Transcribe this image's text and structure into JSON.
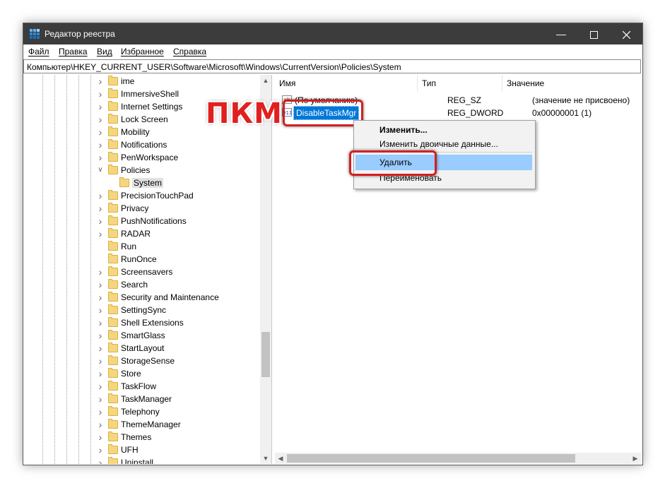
{
  "window": {
    "title": "Редактор реестра"
  },
  "menu": [
    "Файл",
    "Правка",
    "Вид",
    "Избранное",
    "Справка"
  ],
  "address": "Компьютер\\HKEY_CURRENT_USER\\Software\\Microsoft\\Windows\\CurrentVersion\\Policies\\System",
  "tree": {
    "items": [
      {
        "label": "ime",
        "expandable": true
      },
      {
        "label": "ImmersiveShell",
        "expandable": true
      },
      {
        "label": "Internet Settings",
        "expandable": true
      },
      {
        "label": "Lock Screen",
        "expandable": true
      },
      {
        "label": "Mobility",
        "expandable": true
      },
      {
        "label": "Notifications",
        "expandable": true
      },
      {
        "label": "PenWorkspace",
        "expandable": true
      },
      {
        "label": "Policies",
        "expanded": true
      },
      {
        "label": "System",
        "selected": true
      },
      {
        "label": "PrecisionTouchPad",
        "expandable": true
      },
      {
        "label": "Privacy",
        "expandable": true
      },
      {
        "label": "PushNotifications",
        "expandable": true
      },
      {
        "label": "RADAR",
        "expandable": true
      },
      {
        "label": "Run",
        "expandable": false
      },
      {
        "label": "RunOnce",
        "expandable": false
      },
      {
        "label": "Screensavers",
        "expandable": true
      },
      {
        "label": "Search",
        "expandable": true
      },
      {
        "label": "Security and Maintenance",
        "expandable": true
      },
      {
        "label": "SettingSync",
        "expandable": true
      },
      {
        "label": "Shell Extensions",
        "expandable": true
      },
      {
        "label": "SmartGlass",
        "expandable": true
      },
      {
        "label": "StartLayout",
        "expandable": true
      },
      {
        "label": "StorageSense",
        "expandable": true
      },
      {
        "label": "Store",
        "expandable": true
      },
      {
        "label": "TaskFlow",
        "expandable": true
      },
      {
        "label": "TaskManager",
        "expandable": true
      },
      {
        "label": "Telephony",
        "expandable": true
      },
      {
        "label": "ThemeManager",
        "expandable": true
      },
      {
        "label": "Themes",
        "expandable": true
      },
      {
        "label": "UFH",
        "expandable": true
      },
      {
        "label": "Uninstall",
        "expandable": true
      }
    ]
  },
  "columns": {
    "name": "Имя",
    "type": "Тип",
    "value": "Значение"
  },
  "rows": [
    {
      "name": "(По умолчанию)",
      "type": "REG_SZ",
      "value": "(значение не присвоено)",
      "icon": "string-value-icon"
    },
    {
      "name": "DisableTaskMgr",
      "type": "REG_DWORD",
      "value": "0x00000001 (1)",
      "icon": "dword-value-icon"
    }
  ],
  "context_menu": {
    "items": [
      "Изменить...",
      "Изменить двоичные данные...",
      "Удалить",
      "Переименовать"
    ],
    "highlighted": "Удалить"
  },
  "annotation": {
    "label": "ПКМ",
    "color": "#e02020"
  },
  "colors": {
    "titlebar": "#3c3c3c",
    "highlight": "#99ccff",
    "selection": "#0078d7"
  }
}
